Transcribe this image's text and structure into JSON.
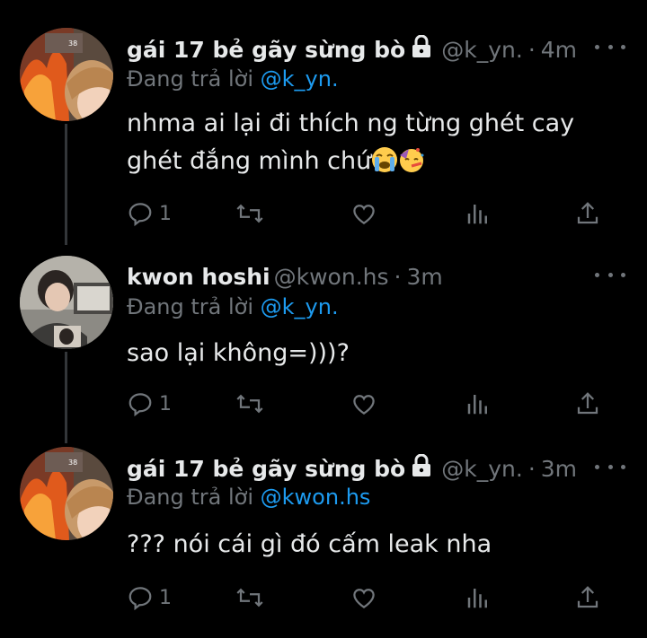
{
  "tweets": [
    {
      "name": "gái 17 bẻ gãy sừng bò",
      "handle": "@k_yn.",
      "time": "4m",
      "reply_prefix": "Đang trả lời",
      "reply_to": "@k_yn.",
      "text": "nhma ai lại đi thích ng từng ghét cay ghét đắng mình chứ",
      "emojis": [
        "loudly-crying-face",
        "partying-face"
      ],
      "reply_count": "1",
      "locked": true,
      "avatar": "girl-fire-avatar"
    },
    {
      "name": "kwon hoshi",
      "handle": "@kwon.hs",
      "time": "3m",
      "reply_prefix": "Đang trả lời",
      "reply_to": "@k_yn.",
      "text": "sao lại không=)))?",
      "reply_count": "1",
      "locked": false,
      "avatar": "boy-photo-avatar"
    },
    {
      "name": "gái 17 bẻ gãy sừng bò",
      "handle": "@k_yn.",
      "time": "3m",
      "reply_prefix": "Đang trả lời",
      "reply_to": "@kwon.hs",
      "text": "??? nói cái gì đó cấm leak nha",
      "reply_count": "1",
      "locked": true,
      "avatar": "girl-fire-avatar"
    }
  ],
  "colors": {
    "background": "#000000",
    "text": "#e7e9ea",
    "muted": "#71767b",
    "mention": "#1d9bf0"
  },
  "icons": [
    "lock-icon",
    "more-icon",
    "reply-icon",
    "retweet-icon",
    "like-icon",
    "views-icon",
    "share-icon"
  ]
}
